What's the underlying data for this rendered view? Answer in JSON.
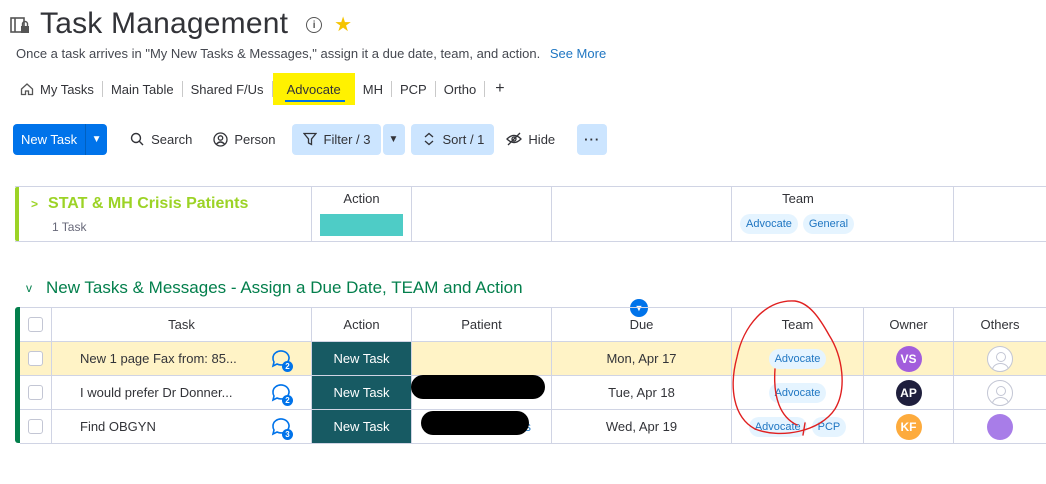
{
  "header": {
    "title": "Task Management",
    "description": "Once a task arrives in \"My New Tasks & Messages,\" assign it a due date, team, and action.",
    "see_more": "See More",
    "info_glyph": "i",
    "star_glyph": "★"
  },
  "tabs": [
    {
      "label": "My Tasks",
      "icon": "home-icon"
    },
    {
      "label": "Main Table"
    },
    {
      "label": "Shared F/Us"
    },
    {
      "label": "Advocate",
      "active": true
    },
    {
      "label": "MH"
    },
    {
      "label": "PCP"
    },
    {
      "label": "Ortho"
    },
    {
      "label": "+"
    }
  ],
  "toolbar": {
    "new_task": "New Task",
    "search": "Search",
    "person": "Person",
    "filter": "Filter / 3",
    "sort": "Sort / 1",
    "hide": "Hide",
    "more": "···"
  },
  "group1": {
    "name": "STAT & MH Crisis Patients",
    "count": "1 Task",
    "color": "#9cd326",
    "columns": {
      "action": "Action",
      "team": "Team"
    },
    "team_chips": [
      "Advocate",
      "General"
    ],
    "action_color": "#4eccc6"
  },
  "group2": {
    "name": "New Tasks & Messages - Assign a Due Date, TEAM and Action",
    "color": "#037f4c",
    "columns": {
      "task": "Task",
      "action": "Action",
      "patient": "Patient",
      "due": "Due",
      "team": "Team",
      "owner": "Owner",
      "others": "Others"
    },
    "rows": [
      {
        "task": "New 1 page Fax from: 85...",
        "updates": "2",
        "action": "New Task",
        "due": "Mon, Apr 17",
        "team": [
          "Advocate"
        ],
        "owner": {
          "initials": "VS",
          "color": "#a25ddc"
        }
      },
      {
        "task": "I would prefer Dr Donner...",
        "updates": "2",
        "action": "New Task",
        "due": "Tue, Apr 18",
        "team": [
          "Advocate"
        ],
        "owner": {
          "initials": "AP",
          "color": "#1f1f3d"
        }
      },
      {
        "task": "Find OBGYN",
        "updates": "3",
        "action": "New Task",
        "patient_suffix": "s",
        "due": "Wed, Apr 19",
        "team": [
          "Advocate",
          "PCP"
        ],
        "owner": {
          "initials": "KF",
          "color": "#fdab3d"
        }
      }
    ],
    "action_color": "#175a63"
  },
  "annotation_color": "#e02020"
}
